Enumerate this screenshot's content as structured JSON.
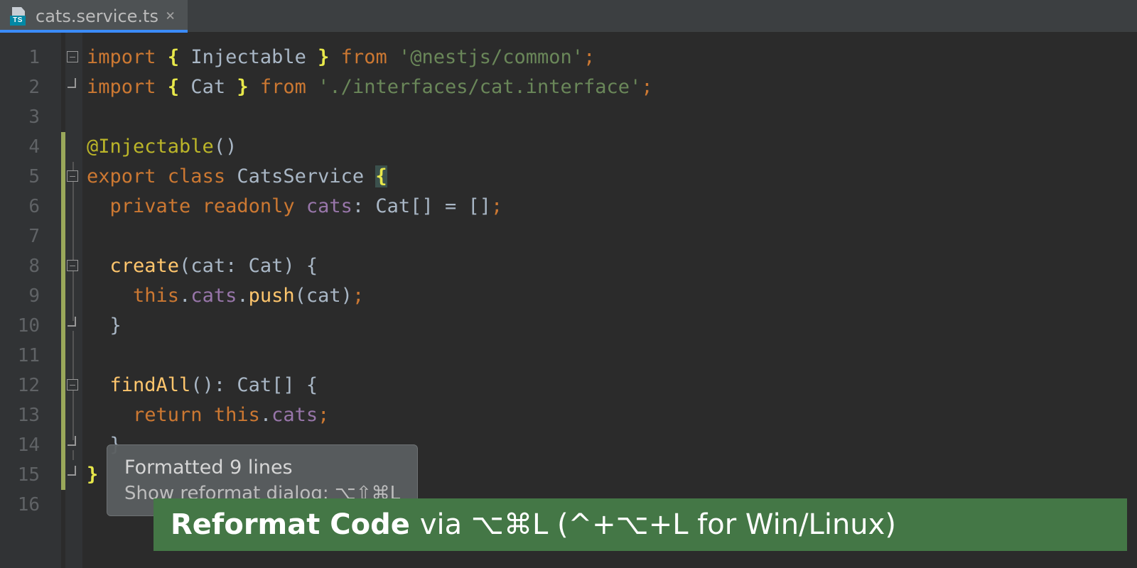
{
  "tab": {
    "filename": "cats.service.ts",
    "icon_badge": "TS"
  },
  "gutter": {
    "lines": [
      "1",
      "2",
      "3",
      "4",
      "5",
      "6",
      "7",
      "8",
      "9",
      "10",
      "11",
      "12",
      "13",
      "14",
      "15",
      "16"
    ]
  },
  "fold_marks": {
    "1": "minus",
    "2": "close",
    "5": "minus",
    "8": "minus",
    "10": "close",
    "12": "minus",
    "14": "close",
    "15": "close"
  },
  "changed_lines": [
    4,
    5,
    6,
    7,
    8,
    9,
    10,
    11,
    12,
    13,
    14,
    15
  ],
  "code": {
    "l1": {
      "kw1": "import",
      "br1": "{",
      "id": " Injectable ",
      "br2": "}",
      "kw2": " from ",
      "str": "'@nestjs/common'",
      "end": ";"
    },
    "l2": {
      "kw1": "import",
      "br1": "{",
      "id": " Cat ",
      "br2": "}",
      "kw2": " from ",
      "str": "'./interfaces/cat.interface'",
      "end": ";"
    },
    "l4": {
      "deco": "@Injectable",
      "call": "()"
    },
    "l5": {
      "kw1": "export ",
      "kw2": "class ",
      "id": "CatsService ",
      "br": "{"
    },
    "l6": {
      "kw1": "private ",
      "kw2": "readonly ",
      "prop": "cats",
      "rest": ": Cat[] = []",
      "end": ";"
    },
    "l8": {
      "fn": "create",
      "sig": "(cat: Cat) {"
    },
    "l9": {
      "kw": "this",
      "dot1": ".",
      "p1": "cats",
      "dot2": ".",
      "fn": "push",
      "args": "(cat)",
      "end": ";"
    },
    "l10": {
      "br": "}"
    },
    "l12": {
      "fn": "findAll",
      "sig": "(): Cat[] {"
    },
    "l13": {
      "kw1": "return ",
      "kw2": "this",
      "dot": ".",
      "p": "cats",
      "end": ";"
    },
    "l14": {
      "br": "}"
    },
    "l15": {
      "br": "}"
    }
  },
  "tooltip": {
    "line1": "Formatted 9 lines",
    "line2": "Show reformat dialog: ⌥⇧⌘L"
  },
  "banner": {
    "strong": "Reformat Code",
    "rest": " via ⌥⌘L (^+⌥+L for Win/Linux)"
  }
}
